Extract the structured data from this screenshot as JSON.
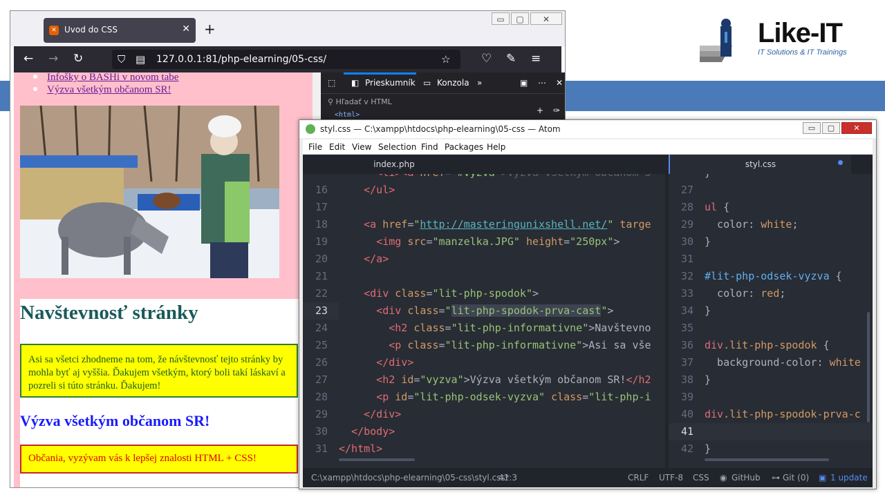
{
  "logo": {
    "brand": "Like-IT",
    "tagline": "IT Solutions & IT Trainings"
  },
  "firefox": {
    "tab_title": "Uvod do CSS",
    "url": "127.0.0.1:81/php-elearning/05-css/",
    "page": {
      "links": [
        "Infošky o BASHi v novom tabe",
        "Výzva všetkým občanom SR!"
      ],
      "visit_heading": "Navštevnosť stránky",
      "visit_text": "Asi sa všetci zhodneme na tom, že návštevnosť tejto stránky by mohla byť aj vyššia. Ďakujem všetkým, ktorý boli takí láskaví a pozreli si túto stránku. Ďakujem!",
      "call_heading": "Výzva všetkým občanom SR!",
      "call_text": "Občania, vyzývam vás k lepšej znalosti HTML + CSS!"
    },
    "devtools": {
      "tab_inspector": "Prieskumník",
      "tab_console": "Konzola",
      "search_placeholder": "Hľadať v HTML",
      "html_node": "<html>"
    }
  },
  "atom": {
    "title": "styl.css — C:\\xampp\\htdocs\\php-elearning\\05-css — Atom",
    "menu": [
      "File",
      "Edit",
      "View",
      "Selection",
      "Find",
      "Packages",
      "Help"
    ],
    "tabs": [
      "index.php",
      "styl.css"
    ],
    "left_lines": [
      {
        "n": "16"
      },
      {
        "n": "17"
      },
      {
        "n": "18"
      },
      {
        "n": "19"
      },
      {
        "n": "20"
      },
      {
        "n": "21"
      },
      {
        "n": "22"
      },
      {
        "n": "23"
      },
      {
        "n": "24"
      },
      {
        "n": "25"
      },
      {
        "n": "26"
      },
      {
        "n": "27"
      },
      {
        "n": "28"
      },
      {
        "n": "29"
      },
      {
        "n": "30"
      },
      {
        "n": "31"
      }
    ],
    "right_lines": [
      {
        "n": "27"
      },
      {
        "n": "28"
      },
      {
        "n": "29"
      },
      {
        "n": "30"
      },
      {
        "n": "31"
      },
      {
        "n": "32"
      },
      {
        "n": "33"
      },
      {
        "n": "34"
      },
      {
        "n": "35"
      },
      {
        "n": "36"
      },
      {
        "n": "37"
      },
      {
        "n": "38"
      },
      {
        "n": "39"
      },
      {
        "n": "40"
      },
      {
        "n": "41"
      },
      {
        "n": "42"
      }
    ],
    "status": {
      "path": "C:\\xampp\\htdocs\\php-elearning\\05-css\\styl.css*",
      "cursor": "41:3",
      "eol": "CRLF",
      "encoding": "UTF-8",
      "grammar": "CSS",
      "github": "GitHub",
      "git": "Git (0)",
      "update": "1 update"
    }
  }
}
